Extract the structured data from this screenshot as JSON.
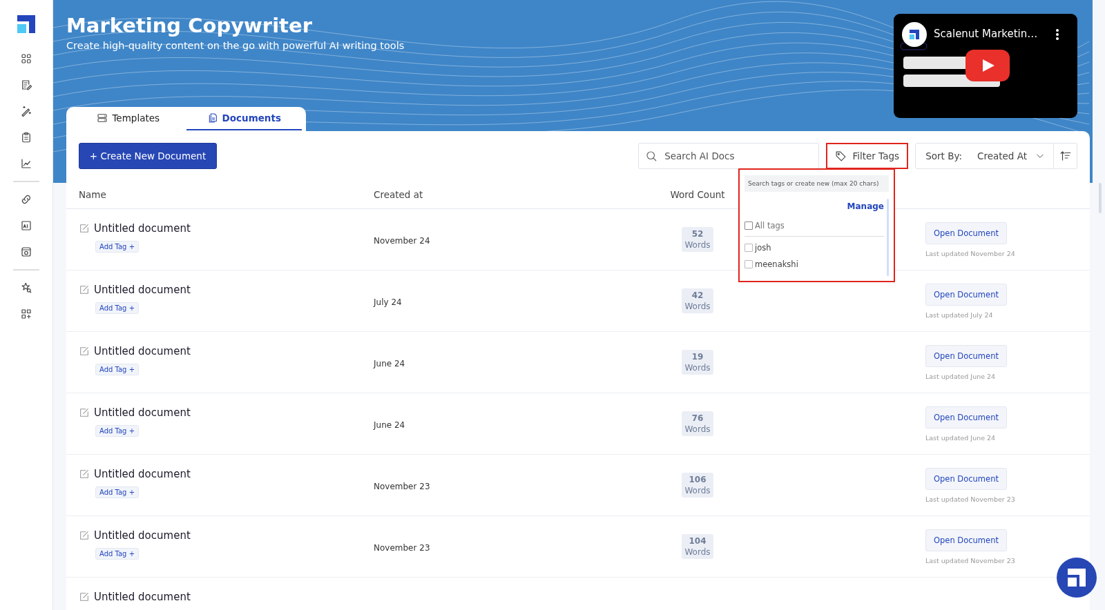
{
  "header": {
    "title": "Marketing Copywriter",
    "subtitle": "Create high-quality content on the go with powerful AI writing tools"
  },
  "video": {
    "title": "Scalenut Marketin…"
  },
  "tabs": [
    {
      "label": "Templates",
      "selected": false
    },
    {
      "label": "Documents",
      "selected": true
    }
  ],
  "toolbar": {
    "create_button": "+ Create New Document",
    "search_placeholder": "Search AI Docs",
    "filter_button": "Filter Tags",
    "sort_label": "Sort By:",
    "sort_value": "Created At"
  },
  "filter_dropdown": {
    "search_placeholder": "Search tags or create new (max 20 chars)",
    "manage": "Manage",
    "all_tags": {
      "label": "All tags",
      "checked": false
    },
    "tags": [
      {
        "label": "josh",
        "checked": false
      },
      {
        "label": "meenakshi",
        "checked": false
      }
    ]
  },
  "table": {
    "columns": [
      "Name",
      "Created at",
      "Word Count"
    ],
    "rows": [
      {
        "name": "Untitled document",
        "tag_button": "Add Tag +",
        "created": "November 24",
        "words": "52",
        "words_label": "Words",
        "action": "Open Document",
        "updated": "Last updated November 24"
      },
      {
        "name": "Untitled document",
        "tag_button": "Add Tag +",
        "created": "July 24",
        "words": "42",
        "words_label": "Words",
        "action": "Open Document",
        "updated": "Last updated July 24"
      },
      {
        "name": "Untitled document",
        "tag_button": "Add Tag +",
        "created": "June 24",
        "words": "19",
        "words_label": "Words",
        "action": "Open Document",
        "updated": "Last updated June 24"
      },
      {
        "name": "Untitled document",
        "tag_button": "Add Tag +",
        "created": "June 24",
        "words": "76",
        "words_label": "Words",
        "action": "Open Document",
        "updated": "Last updated June 24"
      },
      {
        "name": "Untitled document",
        "tag_button": "Add Tag +",
        "created": "November 23",
        "words": "106",
        "words_label": "Words",
        "action": "Open Document",
        "updated": "Last updated November 23"
      },
      {
        "name": "Untitled document",
        "tag_button": "Add Tag +",
        "created": "November 23",
        "words": "104",
        "words_label": "Words",
        "action": "Open Document",
        "updated": "Last updated November 23"
      },
      {
        "name": "Untitled document"
      }
    ]
  }
}
